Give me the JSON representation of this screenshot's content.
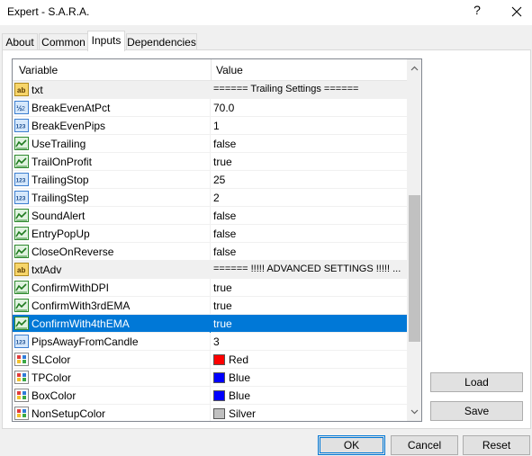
{
  "window": {
    "title": "Expert - S.A.R.A.",
    "help": "?"
  },
  "tabs": [
    {
      "label": "About"
    },
    {
      "label": "Common"
    },
    {
      "label": "Inputs",
      "active": true
    },
    {
      "label": "Dependencies"
    }
  ],
  "grid": {
    "headers": {
      "variable": "Variable",
      "value": "Value"
    },
    "rows": [
      {
        "icon": "ab-icon",
        "name": "txt",
        "value": "====== Trailing Settings ======",
        "group": true
      },
      {
        "icon": "v2-icon",
        "name": "BreakEvenAtPct",
        "value": "70.0"
      },
      {
        "icon": "123-icon",
        "name": "BreakEvenPips",
        "value": "1"
      },
      {
        "icon": "bool-icon",
        "name": "UseTrailing",
        "value": "false"
      },
      {
        "icon": "bool-icon",
        "name": "TrailOnProfit",
        "value": "true"
      },
      {
        "icon": "123-icon",
        "name": "TrailingStop",
        "value": "25"
      },
      {
        "icon": "123-icon",
        "name": "TrailingStep",
        "value": "2"
      },
      {
        "icon": "bool-icon",
        "name": "SoundAlert",
        "value": "false"
      },
      {
        "icon": "bool-icon",
        "name": "EntryPopUp",
        "value": "false"
      },
      {
        "icon": "bool-icon",
        "name": "CloseOnReverse",
        "value": "false"
      },
      {
        "icon": "ab-icon",
        "name": "txtAdv",
        "value": "====== !!!!! ADVANCED SETTINGS !!!!!  ...",
        "group": true
      },
      {
        "icon": "bool-icon",
        "name": "ConfirmWithDPI",
        "value": "true"
      },
      {
        "icon": "bool-icon",
        "name": "ConfirmWith3rdEMA",
        "value": "true"
      },
      {
        "icon": "bool-icon",
        "name": "ConfirmWith4thEMA",
        "value": "true",
        "selected": true
      },
      {
        "icon": "123-icon",
        "name": "PipsAwayFromCandle",
        "value": "3"
      },
      {
        "icon": "color-icon",
        "name": "SLColor",
        "value": "Red",
        "color": "#ff0000"
      },
      {
        "icon": "color-icon",
        "name": "TPColor",
        "value": "Blue",
        "color": "#0000ff"
      },
      {
        "icon": "color-icon",
        "name": "BoxColor",
        "value": "Blue",
        "color": "#0000ff"
      },
      {
        "icon": "color-icon",
        "name": "NonSetupColor",
        "value": "Silver",
        "color": "#c0c0c0"
      }
    ]
  },
  "side_buttons": {
    "load": "Load",
    "save": "Save"
  },
  "footer_buttons": {
    "ok": "OK",
    "cancel": "Cancel",
    "reset": "Reset"
  },
  "colors": {
    "selection": "#0078d7",
    "group_row": "#f0f0f0"
  }
}
